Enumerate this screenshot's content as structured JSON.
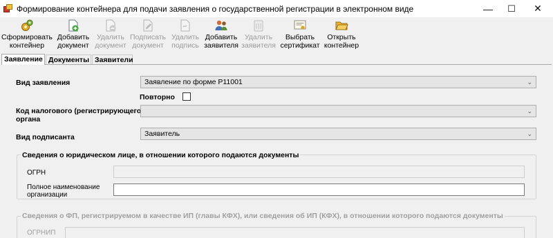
{
  "window": {
    "title": "Формирование контейнера для подачи заявления о государственной регистрации в электронном виде",
    "minimize": "—",
    "maximize": "☐",
    "close": "✕"
  },
  "toolbar": {
    "form_container": "Сформировать\nконтейнер",
    "add_document": "Добавить\nдокумент",
    "delete_document": "Удалить\nдокумент",
    "sign_document": "Подписать\nдокумент",
    "delete_signature": "Удалить\nподпись",
    "add_applicant": "Добавить\nзаявителя",
    "delete_applicant": "Удалить\nзаявителя",
    "select_certificate": "Выбрать\nсертификат",
    "open_container": "Открыть\nконтейнер"
  },
  "tabs": [
    "Заявление",
    "Документы",
    "Заявители"
  ],
  "form": {
    "application_type_label": "Вид заявления",
    "application_type_value": "Заявление по форме Р11001",
    "repeat_label": "Повторно",
    "repeat_checked": false,
    "tax_authority_label": "Код налогового (регистрирующего)\nоргана",
    "tax_authority_value": "",
    "signer_type_label": "Вид подписанта",
    "signer_type_value": "Заявитель"
  },
  "legal_entity_group": {
    "title": "Сведения о юридическом лице, в отношении которого подаются документы",
    "ogrn_label": "ОГРН",
    "ogrn_value": "",
    "full_name_label": "Полное наименование\nорганизации",
    "full_name_value": ""
  },
  "ip_group": {
    "title": "Сведения о ФП, регистрируемом в качестве ИП (главы КФХ), или сведения об ИП (КФХ), в отношении которого подаются документы",
    "ogrnip_label": "ОГРНИП"
  },
  "icons": {
    "form_container": "gears-icon",
    "add_document": "document-add-icon",
    "delete_document": "document-delete-icon",
    "sign_document": "document-sign-icon",
    "delete_signature": "signature-delete-icon",
    "add_applicant": "users-add-icon",
    "delete_applicant": "trash-icon",
    "select_certificate": "certificate-icon",
    "open_container": "folder-open-icon"
  }
}
